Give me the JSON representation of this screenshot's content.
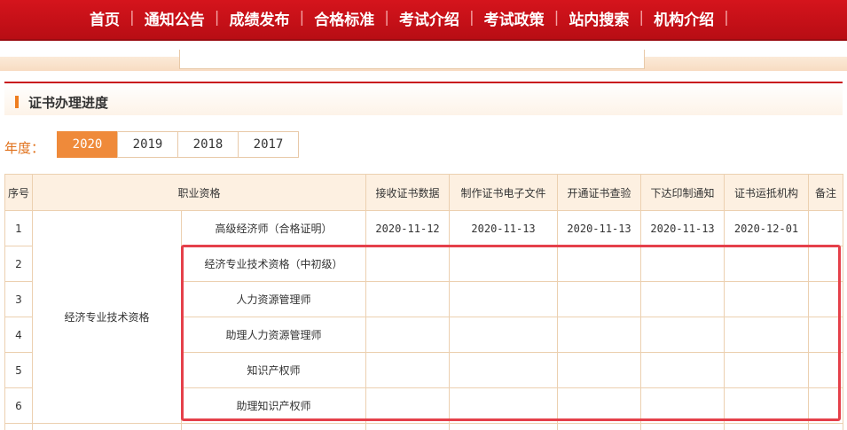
{
  "nav": {
    "items": [
      "首页",
      "通知公告",
      "成绩发布",
      "合格标准",
      "考试介绍",
      "考试政策",
      "站内搜索",
      "机构介绍"
    ],
    "separator": "|"
  },
  "section": {
    "title": "证书办理进度"
  },
  "year_selector": {
    "label": "年度：",
    "years": [
      "2020",
      "2019",
      "2018",
      "2017"
    ],
    "selected": "2020"
  },
  "table": {
    "headers": [
      "序号",
      "职业资格",
      "接收证书数据",
      "制作证书电子文件",
      "开通证书查验",
      "下达印制通知",
      "证书运抵机构",
      "备注"
    ],
    "group_label": "经济专业技术资格",
    "rows": [
      {
        "seq": "1",
        "qualification": "高级经济师（合格证明）",
        "received": "2020-11-12",
        "made": "2020-11-13",
        "opened": "2020-11-13",
        "issued": "2020-11-13",
        "arrived": "2020-12-01",
        "note": ""
      },
      {
        "seq": "2",
        "qualification": "经济专业技术资格（中初级）",
        "received": "",
        "made": "",
        "opened": "",
        "issued": "",
        "arrived": "",
        "note": ""
      },
      {
        "seq": "3",
        "qualification": "人力资源管理师",
        "received": "",
        "made": "",
        "opened": "",
        "issued": "",
        "arrived": "",
        "note": ""
      },
      {
        "seq": "4",
        "qualification": "助理人力资源管理师",
        "received": "",
        "made": "",
        "opened": "",
        "issued": "",
        "arrived": "",
        "note": ""
      },
      {
        "seq": "5",
        "qualification": "知识产权师",
        "received": "",
        "made": "",
        "opened": "",
        "issued": "",
        "arrived": "",
        "note": ""
      },
      {
        "seq": "6",
        "qualification": "助理知识产权师",
        "received": "",
        "made": "",
        "opened": "",
        "issued": "",
        "arrived": "",
        "note": ""
      }
    ]
  },
  "colors": {
    "nav_red": "#c9161d",
    "accent_orange": "#ef8a3a",
    "header_bg": "#fdf0e1",
    "highlight": "#e5404a"
  }
}
